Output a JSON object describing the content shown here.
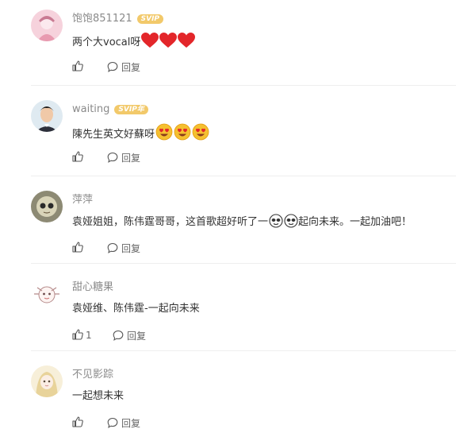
{
  "comments": [
    {
      "username": "饱饱851121",
      "vip": "SVIP",
      "text": "两个大vocal呀",
      "emojis": [
        "heart",
        "heart",
        "heart"
      ],
      "like_count": "",
      "reply_label": "回复",
      "avatar_color": "#f3c6d3"
    },
    {
      "username": "waiting",
      "vip": "SVIP年",
      "text": "陳先生英文好蘇呀",
      "emojis": [
        "heart-eyes",
        "heart-eyes",
        "heart-eyes"
      ],
      "like_count": "",
      "reply_label": "回复",
      "avatar_color": "#d8e6ef"
    },
    {
      "username": "萍萍",
      "vip": "",
      "text": "袁娅姐姐，陈伟霆哥哥，这首歌超好听了一",
      "text_after": "起向未来。一起加油吧！",
      "emojis": [
        "cool",
        "cool"
      ],
      "like_count": "",
      "reply_label": "回复",
      "avatar_color": "#b9b49a"
    },
    {
      "username": "甜心糖果",
      "vip": "",
      "text": "袁娅维、陈伟霆-一起向未来",
      "emojis": [],
      "like_count": "1",
      "reply_label": "回复",
      "avatar_color": "#f5ecec"
    },
    {
      "username": "不见影踪",
      "vip": "",
      "text": "一起想未来",
      "emojis": [],
      "like_count": "",
      "reply_label": "回复",
      "avatar_color": "#f4ead2"
    }
  ],
  "colors": {
    "vip_badge": "#f2c96a",
    "heart": "#e3262a",
    "emoji_face": "#f5c030",
    "divider": "#eeeeee"
  }
}
